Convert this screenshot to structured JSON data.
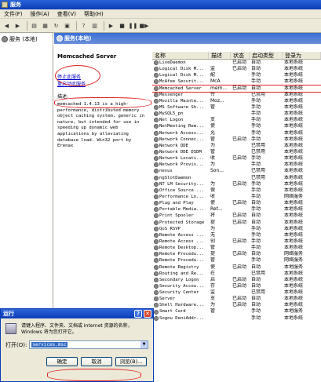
{
  "window": {
    "title": "服务"
  },
  "menu": [
    "文件(F)",
    "操作(A)",
    "查看(V)",
    "帮助(H)"
  ],
  "tree": {
    "root": "服务 (本地)"
  },
  "pane": {
    "header": "服务(本地)"
  },
  "detail": {
    "service_name": "Memcached Server",
    "stop_link": "停止此服务",
    "restart_link": "重启动此服务",
    "desc_label": "描述:",
    "desc_text": "memcached 1.4.13 is a high-performance, distributed memory object caching system, generic in nature, but intended for use in speeding up dynamic web applications by alleviating database load. Win32 port by Erenax"
  },
  "columns": [
    "名称",
    "描述",
    "状态",
    "启动类型",
    "登录为"
  ],
  "services": [
    {
      "name": "LiveDaemon",
      "desc": "",
      "status": "已启动",
      "startup": "自动",
      "logon": "本地系统"
    },
    {
      "name": "Logical Disk M...",
      "desc": "监",
      "status": "已启动",
      "startup": "自动",
      "logon": "本地系统"
    },
    {
      "name": "Logical Disk M...",
      "desc": "配",
      "status": "",
      "startup": "手动",
      "logon": "本地系统"
    },
    {
      "name": "McAfee Securit...",
      "desc": "McA",
      "status": "",
      "startup": "手动",
      "logon": "本地系统"
    },
    {
      "name": "Memcached Server",
      "desc": "mem...",
      "status": "已启动",
      "startup": "自动",
      "logon": "本地系统",
      "selected": true
    },
    {
      "name": "Messenger",
      "desc": "传",
      "status": "",
      "startup": "已禁用",
      "logon": "本地系统"
    },
    {
      "name": "Mozilla Mainte...",
      "desc": "Moz...",
      "status": "",
      "startup": "手动",
      "logon": "本地系统"
    },
    {
      "name": "MS Software Sh...",
      "desc": "管",
      "status": "",
      "startup": "手动",
      "logon": "本地系统"
    },
    {
      "name": "MySQL5_pn",
      "desc": "",
      "status": "",
      "startup": "手动",
      "logon": "本地系统"
    },
    {
      "name": "Net Logon",
      "desc": "支",
      "status": "",
      "startup": "手动",
      "logon": "本地系统"
    },
    {
      "name": "NetMeeting Rem...",
      "desc": "使",
      "status": "",
      "startup": "手动",
      "logon": "本地系统"
    },
    {
      "name": "Network Access...",
      "desc": "允",
      "status": "",
      "startup": "手动",
      "logon": "本地系统"
    },
    {
      "name": "Network Connec...",
      "desc": "管",
      "status": "已启动",
      "startup": "手动",
      "logon": "本地系统"
    },
    {
      "name": "Network DDE",
      "desc": "为",
      "status": "",
      "startup": "已禁用",
      "logon": "本地系统"
    },
    {
      "name": "Network DDE DSDM",
      "desc": "管",
      "status": "",
      "startup": "已禁用",
      "logon": "本地系统"
    },
    {
      "name": "Network Locati...",
      "desc": "收",
      "status": "已启动",
      "startup": "手动",
      "logon": "本地系统"
    },
    {
      "name": "Network Provis...",
      "desc": "为",
      "status": "",
      "startup": "手动",
      "logon": "本地系统"
    },
    {
      "name": "nexus",
      "desc": "Son...",
      "status": "",
      "startup": "已禁用",
      "logon": "本地系统"
    },
    {
      "name": "ngSlotDaemon",
      "desc": "",
      "status": "",
      "startup": "已禁用",
      "logon": "本地系统"
    },
    {
      "name": "NT LM Security...",
      "desc": "为",
      "status": "已启动",
      "startup": "手动",
      "logon": "本地系统"
    },
    {
      "name": "Office Source ...",
      "desc": "保",
      "status": "",
      "startup": "手动",
      "logon": "本地系统"
    },
    {
      "name": "Performance Lo...",
      "desc": "收",
      "status": "",
      "startup": "手动",
      "logon": "网络服务"
    },
    {
      "name": "Plug and Play",
      "desc": "使",
      "status": "已启动",
      "startup": "自动",
      "logon": "本地系统"
    },
    {
      "name": "Portable Media...",
      "desc": "Ret...",
      "status": "",
      "startup": "手动",
      "logon": "本地系统"
    },
    {
      "name": "Print Spooler",
      "desc": "将",
      "status": "已启动",
      "startup": "自动",
      "logon": "本地系统"
    },
    {
      "name": "Protected Storage",
      "desc": "提",
      "status": "已启动",
      "startup": "自动",
      "logon": "本地系统"
    },
    {
      "name": "QoS RSVP",
      "desc": "为",
      "status": "",
      "startup": "手动",
      "logon": "本地系统"
    },
    {
      "name": "Remote Access ...",
      "desc": "无",
      "status": "",
      "startup": "手动",
      "logon": "本地系统"
    },
    {
      "name": "Remote Access ...",
      "desc": "创",
      "status": "已启动",
      "startup": "手动",
      "logon": "本地系统"
    },
    {
      "name": "Remote Desktop...",
      "desc": "管",
      "status": "",
      "startup": "手动",
      "logon": "本地系统"
    },
    {
      "name": "Remote Procedu...",
      "desc": "提",
      "status": "已启动",
      "startup": "自动",
      "logon": "网络服务"
    },
    {
      "name": "Remote Procedu...",
      "desc": "管",
      "status": "",
      "startup": "手动",
      "logon": "网络服务"
    },
    {
      "name": "Remote Registry",
      "desc": "使",
      "status": "已启动",
      "startup": "自动",
      "logon": "本地服务"
    },
    {
      "name": "Routing and Re...",
      "desc": "在",
      "status": "",
      "startup": "已禁用",
      "logon": "本地系统"
    },
    {
      "name": "Secondary Logon",
      "desc": "启",
      "status": "已启动",
      "startup": "自动",
      "logon": "本地系统"
    },
    {
      "name": "Security Accou...",
      "desc": "存",
      "status": "已启动",
      "startup": "自动",
      "logon": "本地系统"
    },
    {
      "name": "Security Center",
      "desc": "监",
      "status": "",
      "startup": "已禁用",
      "logon": "本地系统"
    },
    {
      "name": "Server",
      "desc": "支",
      "status": "已启动",
      "startup": "自动",
      "logon": "本地系统"
    },
    {
      "name": "Shell Hardware...",
      "desc": "为",
      "status": "已启动",
      "startup": "自动",
      "logon": "本地系统"
    },
    {
      "name": "Smart Card",
      "desc": "管",
      "status": "",
      "startup": "手动",
      "logon": "本地服务"
    },
    {
      "name": "Sogou DeniAddr...",
      "desc": "",
      "status": "",
      "startup": "手动",
      "logon": "本地系统"
    }
  ],
  "run_dialog": {
    "title": "运行",
    "message": "请键入程序、文件夹、文档或 Internet 资源的名称，Windows 将为您打开它。",
    "open_label": "打开(O):",
    "input_value": "services.msc",
    "ok": "确定",
    "cancel": "取消",
    "browse": "浏览(B)..."
  },
  "colors": {
    "highlight": "#e02020",
    "titlebar": "#0a3cb8"
  }
}
